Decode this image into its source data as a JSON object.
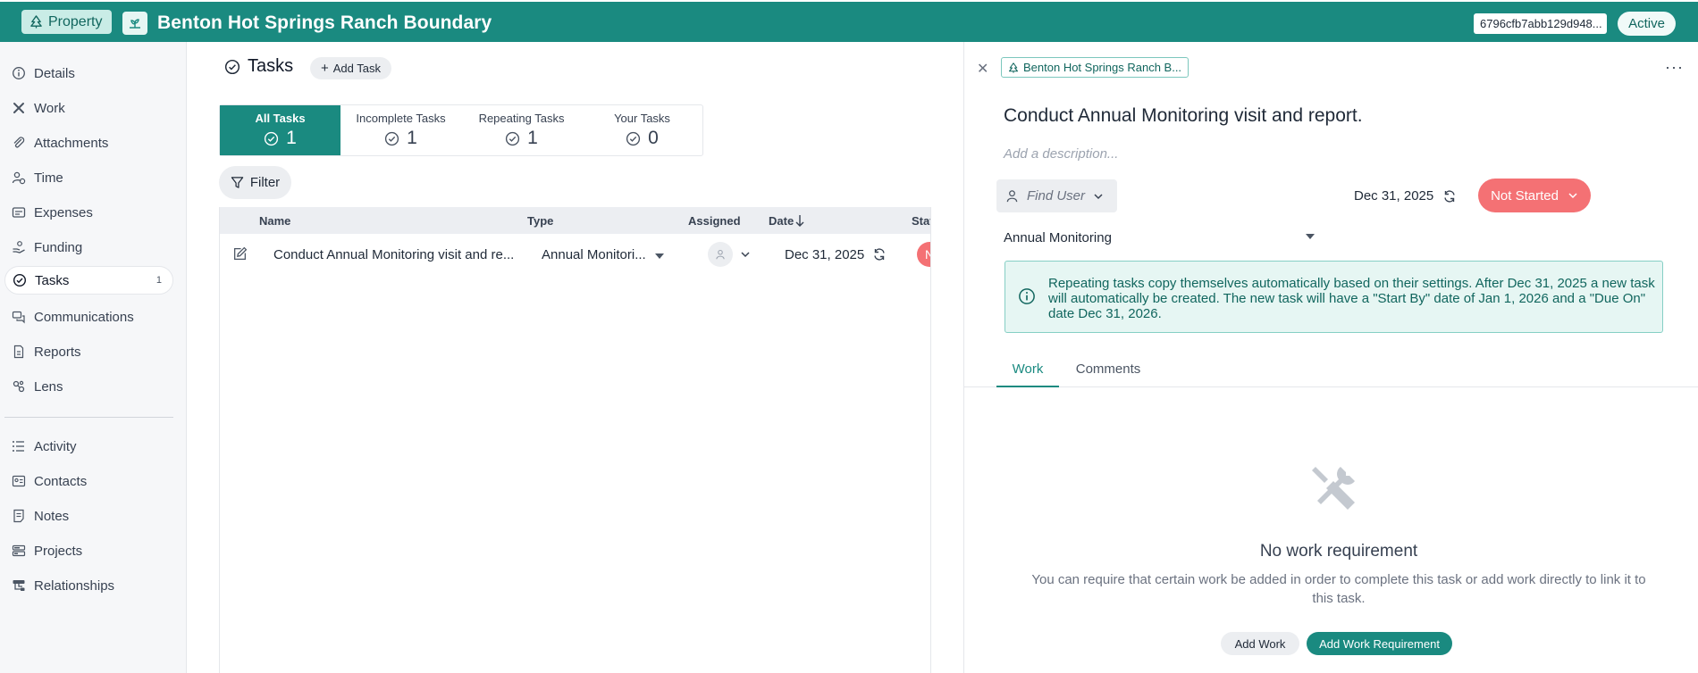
{
  "header": {
    "property_label": "Property",
    "title": "Benton Hot Springs Ranch Boundary",
    "record_id": "6796cfb7abb129d948...",
    "status_label": "Active"
  },
  "sidebar": {
    "items": [
      {
        "label": "Details",
        "icon": "info-icon"
      },
      {
        "label": "Work",
        "icon": "tools-icon"
      },
      {
        "label": "Attachments",
        "icon": "paperclip-icon"
      },
      {
        "label": "Time",
        "icon": "user-clock-icon"
      },
      {
        "label": "Expenses",
        "icon": "receipt-icon"
      },
      {
        "label": "Funding",
        "icon": "hand-coin-icon"
      },
      {
        "label": "Tasks",
        "icon": "check-circle-icon",
        "count": "1",
        "active": true
      },
      {
        "label": "Communications",
        "icon": "chat-icon"
      },
      {
        "label": "Reports",
        "icon": "document-icon"
      },
      {
        "label": "Lens",
        "icon": "lens-icon"
      },
      {
        "label": "Activity",
        "icon": "list-icon"
      },
      {
        "label": "Contacts",
        "icon": "contact-card-icon"
      },
      {
        "label": "Notes",
        "icon": "note-icon"
      },
      {
        "label": "Projects",
        "icon": "projects-icon"
      },
      {
        "label": "Relationships",
        "icon": "relationships-icon"
      }
    ]
  },
  "main": {
    "title": "Tasks",
    "add_task_label": "Add Task",
    "tabs": [
      {
        "label": "All Tasks",
        "count": "1",
        "active": true
      },
      {
        "label": "Incomplete Tasks",
        "count": "1"
      },
      {
        "label": "Repeating Tasks",
        "count": "1"
      },
      {
        "label": "Your Tasks",
        "count": "0"
      }
    ],
    "filter_label": "Filter",
    "table": {
      "columns": [
        "Name",
        "Type",
        "Assigned",
        "Date",
        "Stat"
      ],
      "rows": [
        {
          "name": "Conduct Annual Monitoring visit and re...",
          "type": "Annual Monitori...",
          "date": "Dec 31, 2025",
          "status_initial": "N"
        }
      ]
    }
  },
  "panel": {
    "breadcrumb": "Benton Hot Springs Ranch B...",
    "title": "Conduct Annual Monitoring visit and report.",
    "description_placeholder": "Add a description...",
    "find_user_placeholder": "Find User",
    "due_date": "Dec 31, 2025",
    "status": "Not Started",
    "type": "Annual Monitoring",
    "info": "Repeating tasks copy themselves automatically based on their settings. After Dec 31, 2025 a new task will automatically be created. The new task will have a \"Start By\" date of Jan 1, 2026 and a \"Due On\" date Dec 31, 2026.",
    "tabs": [
      {
        "label": "Work",
        "active": true
      },
      {
        "label": "Comments"
      }
    ],
    "empty_title": "No work requirement",
    "empty_sub": "You can require that certain work be added in order to complete this task or add work directly to link it to this task.",
    "add_work_label": "Add Work",
    "add_requirement_label": "Add Work Requirement"
  },
  "colors": {
    "brand": "#1a8a80",
    "status_not_started": "#f47174",
    "info_bg": "#e6f6f3"
  }
}
